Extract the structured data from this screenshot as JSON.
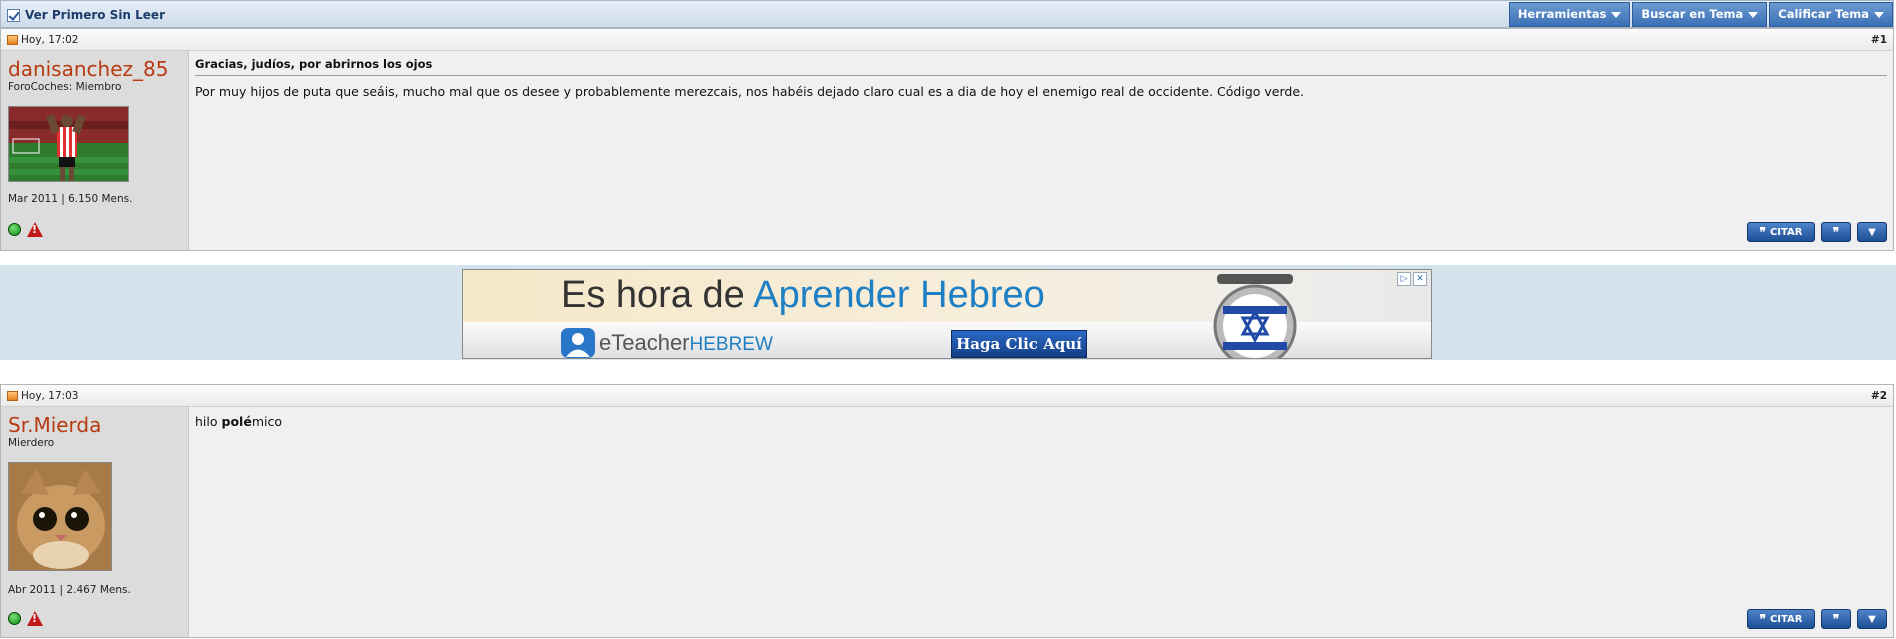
{
  "toolbar": {
    "unread_label": "Ver Primero Sin Leer",
    "menus": [
      "Herramientas",
      "Buscar en Tema",
      "Calificar Tema"
    ]
  },
  "posts": [
    {
      "date": "Hoy, 17:02",
      "number": "#1",
      "username": "danisanchez_85",
      "usertitle": "ForoCoches: Miembro",
      "stats": "Mar 2011 | 6.150 Mens.",
      "title": "Gracias, judíos, por abrirnos los ojos",
      "text": "Por muy hijos de puta que seáis, mucho mal que os desee y probablemente merezcais, nos habéis dejado claro cual es a dia de hoy el enemigo real de occidente. Código verde.",
      "quote_label": "CITAR"
    },
    {
      "date": "Hoy, 17:03",
      "number": "#2",
      "username": "Sr.Mierda",
      "usertitle": "Mierdero",
      "stats": "Abr 2011 | 2.467 Mens.",
      "text_parts": [
        "hilo ",
        "polé",
        "mico"
      ],
      "quote_label": "CITAR"
    }
  ],
  "ad": {
    "headline_part1": "Es hora de ",
    "headline_part2": "Aprender Hebreo",
    "logo_part1": "eTeacher",
    "logo_part2": "HEBREW",
    "cta": "Haga Clic Aquí",
    "info_glyph": "▷",
    "close_glyph": "✕"
  },
  "colors": {
    "username": "#b83a10",
    "toolbar_button": "#3a6fb5",
    "ad_highlight": "#1e7fc4"
  }
}
